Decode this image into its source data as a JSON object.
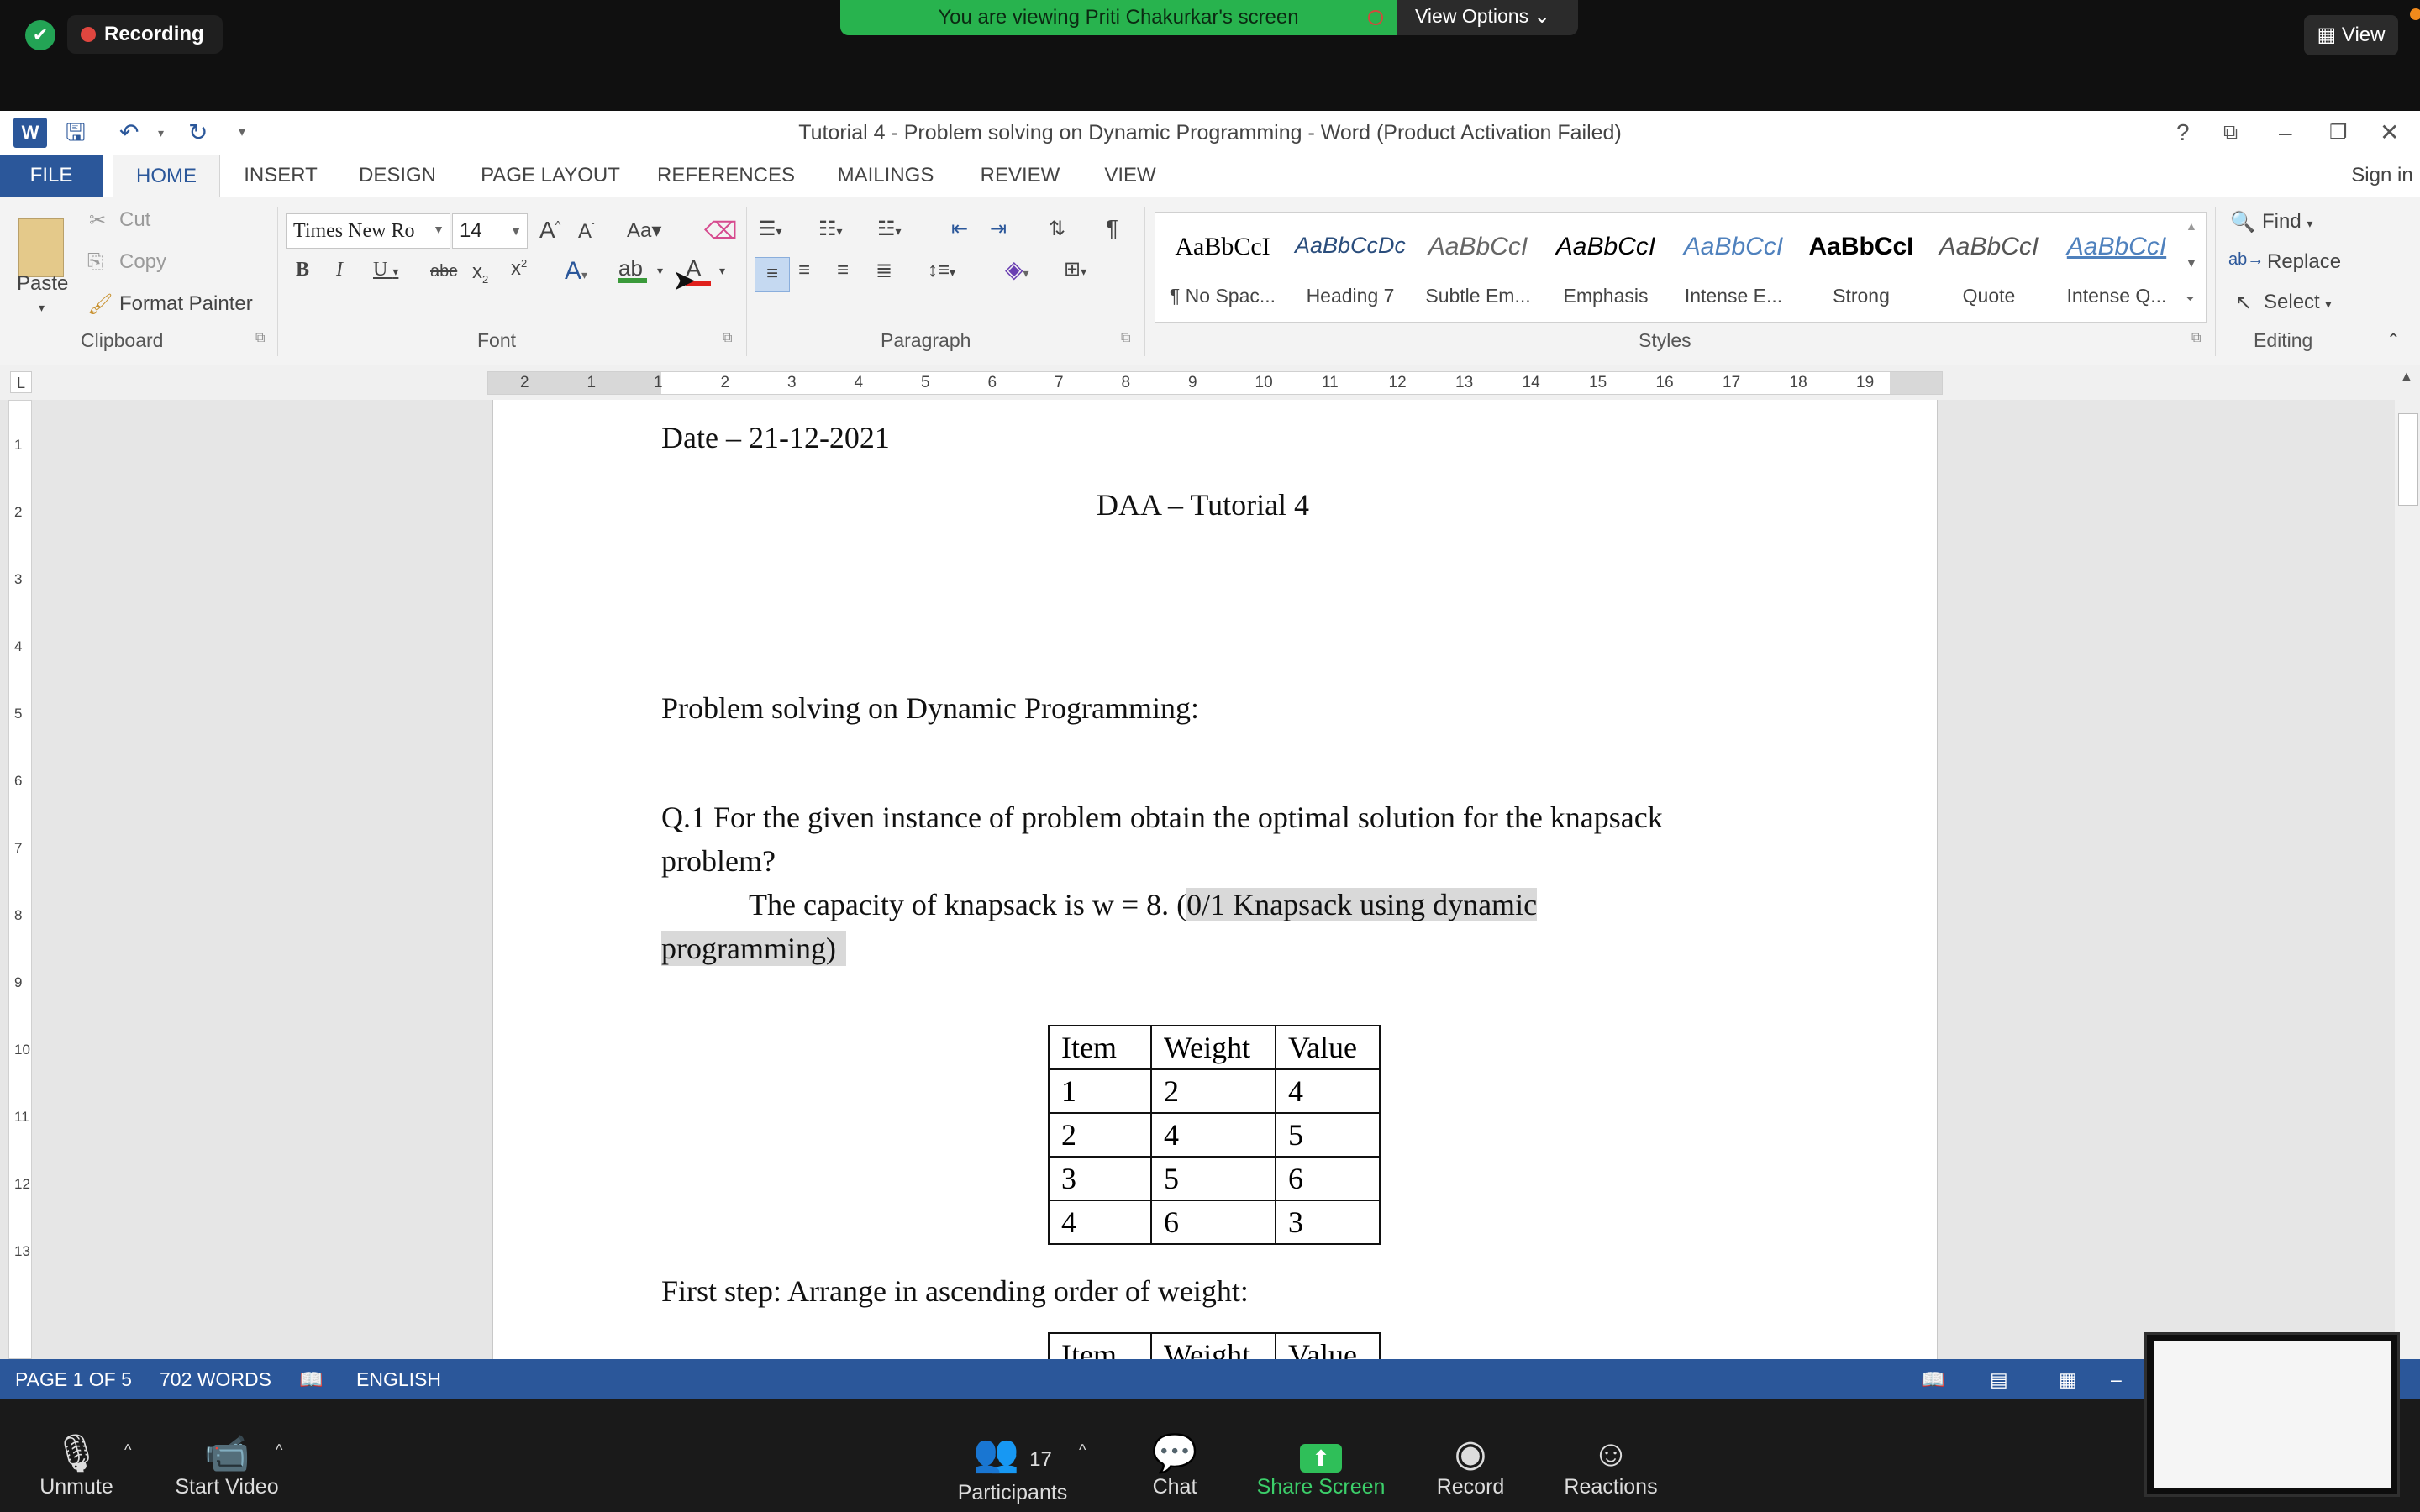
{
  "zoom_top": {
    "recording": "Recording",
    "viewing_banner": "You are viewing Priti Chakurkar's screen",
    "view_options": "View Options ⌄",
    "view_button": "View"
  },
  "word": {
    "title": "Tutorial 4 - Problem solving on Dynamic Programming - Word (Product Activation Failed)",
    "help": "?",
    "sign_in": "Sign in",
    "tabs": [
      "FILE",
      "HOME",
      "INSERT",
      "DESIGN",
      "PAGE LAYOUT",
      "REFERENCES",
      "MAILINGS",
      "REVIEW",
      "VIEW"
    ],
    "clipboard": {
      "paste": "Paste",
      "cut": "Cut",
      "copy": "Copy",
      "format_painter": "Format Painter",
      "label": "Clipboard"
    },
    "font": {
      "name": "Times New Ro",
      "size": "14",
      "label": "Font"
    },
    "paragraph": {
      "label": "Paragraph"
    },
    "styles": {
      "label": "Styles",
      "items": [
        {
          "sample": "AaBbCcI",
          "name": "¶ No Spac..."
        },
        {
          "sample": "AaBbCcDc",
          "name": "Heading 7"
        },
        {
          "sample": "AaBbCcI",
          "name": "Subtle Em..."
        },
        {
          "sample": "AaBbCcI",
          "name": "Emphasis"
        },
        {
          "sample": "AaBbCcI",
          "name": "Intense E..."
        },
        {
          "sample": "AaBbCcI",
          "name": "Strong"
        },
        {
          "sample": "AaBbCcI",
          "name": "Quote"
        },
        {
          "sample": "AaBbCcI",
          "name": "Intense Q..."
        }
      ]
    },
    "editing": {
      "find": "Find",
      "replace": "Replace",
      "select": "Select",
      "label": "Editing"
    },
    "ruler_numbers": [
      "2",
      "1",
      "1",
      "2",
      "3",
      "4",
      "5",
      "6",
      "7",
      "8",
      "9",
      "10",
      "11",
      "12",
      "13",
      "14",
      "15",
      "16",
      "17",
      "18",
      "19"
    ],
    "vruler_numbers": [
      "1",
      "2",
      "3",
      "4",
      "5",
      "6",
      "7",
      "8",
      "9",
      "10",
      "11",
      "12",
      "13"
    ],
    "document": {
      "date": "Date – 21-12-2021",
      "heading": "DAA – Tutorial 4",
      "subheading": "Problem solving on Dynamic Programming:",
      "q1_line1": "Q.1 For the given instance of problem obtain the optimal solution for the knapsack",
      "q1_line2": "problem?",
      "capacity_plain": "The capacity of knapsack is w = 8. (",
      "capacity_highlight1": "0/1 Knapsack using dynamic",
      "capacity_highlight2": "programming)",
      "table_headers": [
        "Item",
        "Weight",
        "Value"
      ],
      "table_rows": [
        [
          "1",
          "2",
          "4"
        ],
        [
          "2",
          "4",
          "5"
        ],
        [
          "3",
          "5",
          "6"
        ],
        [
          "4",
          "6",
          "3"
        ]
      ],
      "first_step": "First step: Arrange in ascending order of weight:",
      "table2_headers": [
        "Item",
        "Weight",
        "Value"
      ]
    },
    "status": {
      "page": "PAGE 1 OF 5",
      "words": "702 WORDS",
      "language": "ENGLISH"
    }
  },
  "zoom_bottom": {
    "unmute": "Unmute",
    "start_video": "Start Video",
    "participants": "Participants",
    "participant_count": "17",
    "chat": "Chat",
    "share_screen": "Share Screen",
    "record": "Record",
    "reactions": "Reactions"
  }
}
